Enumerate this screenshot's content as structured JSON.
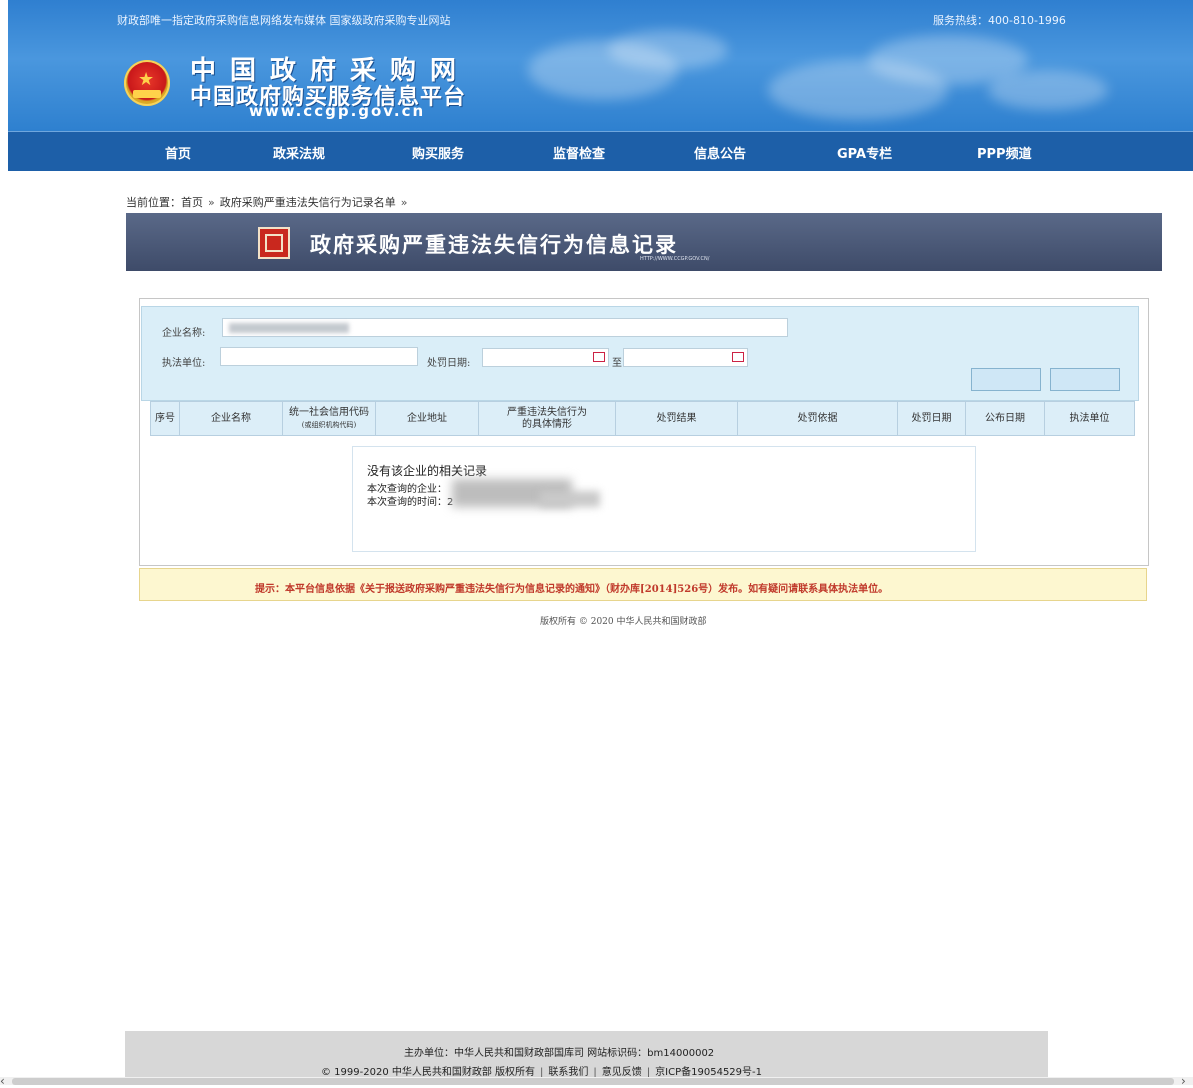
{
  "header": {
    "top_left": "财政部唯一指定政府采购信息网络发布媒体  国家级政府采购专业网站",
    "hotline": "服务热线：400-810-1996",
    "logo_line1": "中国政府采购网",
    "logo_line2": "中国政府购买服务信息平台",
    "logo_url": "www.ccgp.gov.cn"
  },
  "nav": {
    "items": [
      {
        "label": "首页"
      },
      {
        "label": "政采法规"
      },
      {
        "label": "购买服务"
      },
      {
        "label": "监督检查"
      },
      {
        "label": "信息公告"
      },
      {
        "label": "GPA专栏"
      },
      {
        "label": "PPP频道"
      }
    ]
  },
  "breadcrumb": {
    "prefix": "当前位置：",
    "home": "首页",
    "sep": "»",
    "current": "政府采购严重违法失信行为记录名单"
  },
  "title_bar": {
    "title": "政府采购严重违法失信行为信息记录",
    "subtitle": "HTTP://WWW.CCGP.GOV.CN/"
  },
  "search": {
    "company_label": "企业名称:",
    "agency_label": "执法单位:",
    "date_label": "处罚日期:",
    "to_label": "至"
  },
  "table": {
    "headers": [
      {
        "text": "序号"
      },
      {
        "text": "企业名称"
      },
      {
        "text": "统一社会信用代码",
        "sub": "(或组织机构代码)"
      },
      {
        "text": "企业地址"
      },
      {
        "text": "严重违法失信行为",
        "sub2": "的具体情形"
      },
      {
        "text": "处罚结果"
      },
      {
        "text": "处罚依据"
      },
      {
        "text": "处罚日期"
      },
      {
        "text": "公布日期"
      },
      {
        "text": "执法单位"
      }
    ]
  },
  "message": {
    "title": "没有该企业的相关记录",
    "company_prefix": "本次查询的企业：",
    "time_prefix": "本次查询的时间：2"
  },
  "tip": "提示：本平台信息依据《关于报送政府采购严重违法失信行为信息记录的通知》（财办库[2014]526号）发布。如有疑问请联系具体执法单位。",
  "copyright": "版权所有 © 2020 中华人民共和国财政部",
  "footer": {
    "line1": "主办单位：中华人民共和国财政部国库司  网站标识码：bm14000002",
    "line2_a": "© 1999-2020  中华人民共和国财政部  版权所有",
    "contact": "联系我们",
    "feedback": "意见反馈",
    "icp": "京ICP备19054529号-1",
    "bar": "|"
  },
  "scroll": {
    "left": "‹",
    "right": "›"
  }
}
